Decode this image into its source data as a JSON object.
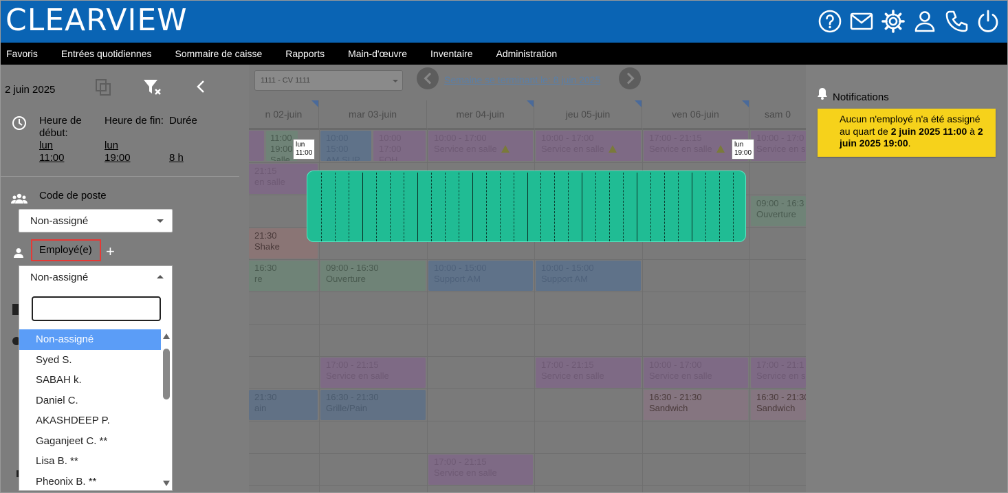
{
  "app": {
    "logo": "CLEARVIEW",
    "top_icons": [
      "help-icon",
      "mail-icon",
      "gear-icon",
      "user-icon",
      "phone-icon",
      "power-icon"
    ]
  },
  "menu": [
    "Favoris",
    "Entrées quotidiennes",
    "Sommaire de caisse",
    "Rapports",
    "Main-d'œuvre",
    "Inventaire",
    "Administration"
  ],
  "shift_panel": {
    "date": "2 juin 2025",
    "start_label_1": "Heure de",
    "start_label_2": "début:",
    "start_day": "lun",
    "start_time": "11:00",
    "end_label": "Heure de fin:",
    "end_day": "lun",
    "end_time": "19:00",
    "duration_label": "Durée",
    "duration_value": "8 h",
    "poste_label": "Code de poste",
    "poste_value": "Non-assigné",
    "employee_label": "Employé(e)",
    "plus": "+",
    "employee_selected": "Non-assigné",
    "employee_search_value": "",
    "employee_options": [
      "Non-assigné",
      "Syed S.",
      "SABAH k.",
      "Daniel C.",
      "AKASHDEEP P.",
      "Gaganjeet C. **",
      "Lisa B. **",
      "Pheonix B. **"
    ]
  },
  "calendar": {
    "store": "1111 - CV 1111",
    "week_label": "Semaine se terminant le: 8 juin 2025",
    "days": [
      "n 02-juin",
      "mar 03-juin",
      "mer 04-juin",
      "jeu 05-juin",
      "ven 06-juin",
      "sam 0"
    ],
    "tooltip_start_day": "lun",
    "tooltip_start_time": "11:00",
    "tooltip_end_day": "lun",
    "tooltip_end_time": "19:00",
    "shifts": {
      "a1": "11:00",
      "a2": "19:00",
      "a3": "Salle",
      "b1": "10:00",
      "b2": "15:00",
      "b3": "AM SUP",
      "c1": "10:00",
      "c2": "17:00",
      "c3": "FOH",
      "d1": "10:00 - 17:00",
      "d2": "Service en salle",
      "e1": "10:00 - 17:00",
      "e2": "Service en salle",
      "f1": "17:00 - 21:15",
      "f2": "Service en salle",
      "g1": "10:00 - 17:0",
      "g2": "Service en s",
      "h1": "21:15",
      "h2": "en salle",
      "i1": "09:00 - 16:3",
      "i2": "Ouverture",
      "j1": "21:30",
      "j2": "Shake",
      "k1": "16:30",
      "k2": "re",
      "l1": "09:00 - 16:30",
      "l2": "Ouverture",
      "m1": "10:00 - 15:00",
      "m2": "Support AM",
      "n1": "10:00 - 15:00",
      "n2": "Support AM",
      "o1": "17:00 - 21:15",
      "o2": "Service en salle",
      "p1": "17:00 - 21:15",
      "p2": "Service en salle",
      "q1": "10:00 - 17:00",
      "q2": "Service en salle",
      "r1": "17:00 - 21:1",
      "r2": "Service en s",
      "s1": "21:30",
      "s2": "ain",
      "t1": "16:30 - 21:30",
      "t2": "Grille/Pain",
      "u1": "16:30 - 21:30",
      "u2": "Sandwich",
      "v1": "16:30 - 21:30",
      "v2": "Sandwich",
      "w1": "17:00 - 21:15",
      "w2": "Service en salle"
    }
  },
  "notifications": {
    "title": "Notifications",
    "text_1": "Aucun n'employé n'a été assigné au quart de ",
    "bold_1": "2 juin 2025 11:00",
    "text_2": " à ",
    "bold_2": "2 juin 2025 19:00",
    "text_3": "."
  },
  "colors": {
    "header_blue": "#0a64b4",
    "drag_green": "#20bc94",
    "notif_yellow": "#f6d21b",
    "selected_blue": "#5b9df7",
    "highlight_red": "#e53935"
  }
}
